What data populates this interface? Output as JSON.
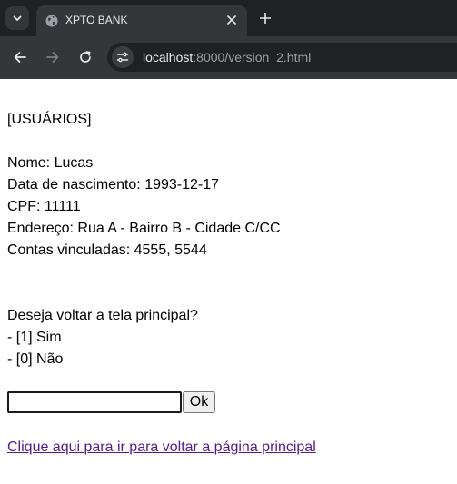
{
  "browser": {
    "tab": {
      "title": "XPTO BANK"
    },
    "address": {
      "host": "localhost",
      "path": ":8000/version_2.html"
    }
  },
  "page": {
    "heading": "[USUÁRIOS]",
    "user": {
      "name": "Nome: Lucas",
      "birth_date": "Data de nascimento: 1993-12-17",
      "cpf": "CPF: 11111",
      "address": "Endereço: Rua A - Bairro B - Cidade C/CC",
      "linked_accounts": "Contas vinculadas: 4555, 5544"
    },
    "prompt": {
      "question": "Deseja voltar a tela principal?",
      "options": [
        "- [1] Sim",
        "- [0] Não"
      ]
    },
    "form": {
      "input_value": "",
      "ok_label": "Ok"
    },
    "link": "Clique aqui para ir para voltar a página principal"
  }
}
